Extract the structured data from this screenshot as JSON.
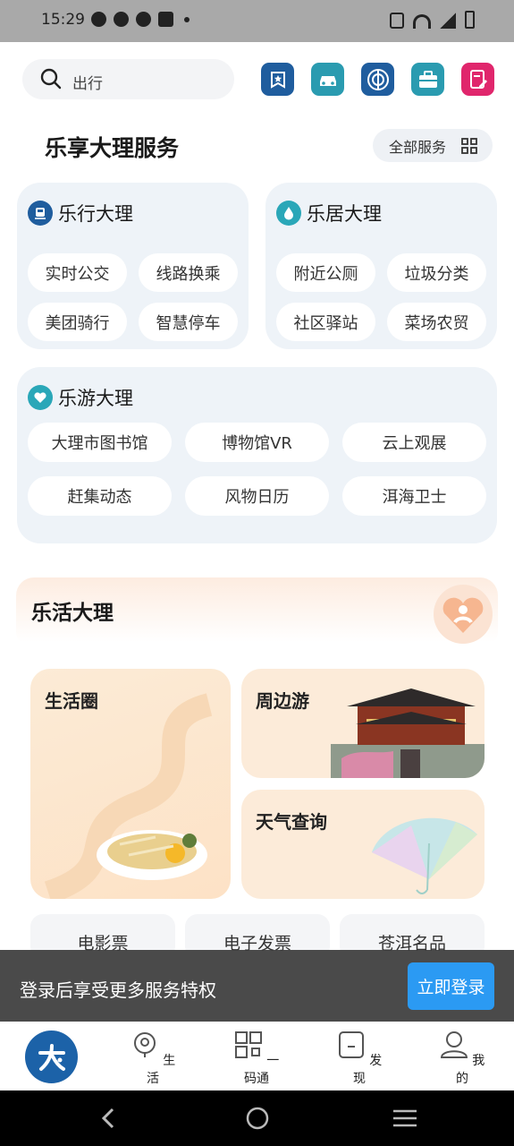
{
  "status": {
    "time": "15:29"
  },
  "search": {
    "placeholder": "出行"
  },
  "top_icons": [
    {
      "name": "bookmark-star-icon",
      "color": "#1f5d9e"
    },
    {
      "name": "car-icon",
      "color": "#2a9bb0"
    },
    {
      "name": "metro-icon",
      "color": "#1f5d9e"
    },
    {
      "name": "briefcase-icon",
      "color": "#2a9bb0"
    },
    {
      "name": "edit-document-icon",
      "color": "#e0266c"
    }
  ],
  "services": {
    "title": "乐享大理服务",
    "all_label": "全部服务",
    "lexing": {
      "title": "乐行大理",
      "items": [
        "实时公交",
        "线路换乘",
        "美团骑行",
        "智慧停车"
      ]
    },
    "leju": {
      "title": "乐居大理",
      "items": [
        "附近公厕",
        "垃圾分类",
        "社区驿站",
        "菜场农贸"
      ]
    },
    "leyou": {
      "title": "乐游大理",
      "items": [
        "大理市图书馆",
        "博物馆VR",
        "云上观展",
        "赶集动态",
        "风物日历",
        "洱海卫士"
      ]
    }
  },
  "lehuo": {
    "title": "乐活大理",
    "tiles": {
      "life": "生活圈",
      "tour": "周边游",
      "weather": "天气查询"
    },
    "mini": [
      "电影票",
      "电子发票",
      "苍洱名品"
    ]
  },
  "login": {
    "message": "登录后享受更多服务特权",
    "button": "立即登录"
  },
  "tabbar": {
    "items": [
      "生活",
      "一码通",
      "发现",
      "我的"
    ]
  },
  "colors": {
    "brand": "#1c62a8",
    "accent": "#2b9af3"
  }
}
